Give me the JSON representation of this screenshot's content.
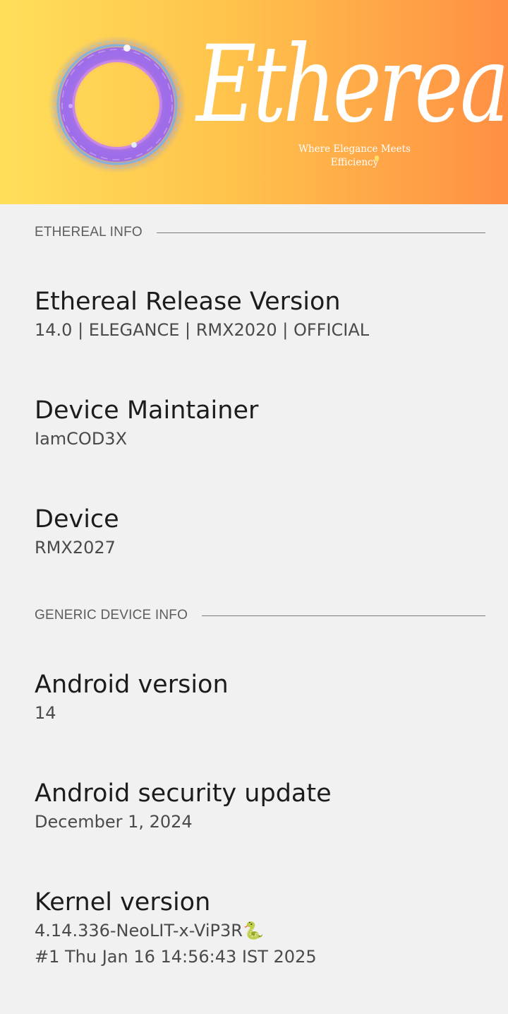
{
  "banner": {
    "title": "Ethereal",
    "tagline_line1": "Where Elegance Meets",
    "tagline_line2": "Efficiency",
    "logo_icon": "purple-ring-icon"
  },
  "sections": {
    "ethereal_info": {
      "header": "ETHEREAL INFO",
      "items": [
        {
          "title": "Ethereal Release Version",
          "summary": "14.0 | ELEGANCE | RMX2020 | OFFICIAL"
        },
        {
          "title": "Device Maintainer",
          "summary": "IamCOD3X"
        },
        {
          "title": "Device",
          "summary": "RMX2027"
        }
      ]
    },
    "generic_device_info": {
      "header": "GENERIC DEVICE INFO",
      "items": [
        {
          "title": "Android version",
          "summary": "14"
        },
        {
          "title": "Android security update",
          "summary": "December 1, 2024"
        },
        {
          "title": "Kernel version",
          "summary_line1": "4.14.336-NeoLIT-x-ViP3R🐍",
          "summary_line2": "#1 Thu Jan 16 14:56:43 IST 2025"
        }
      ]
    }
  },
  "colors": {
    "banner_start": "#ffdf5a",
    "banner_end": "#ff8f44",
    "background": "#f1f1f1",
    "ring_accent": "#8a5cff"
  }
}
